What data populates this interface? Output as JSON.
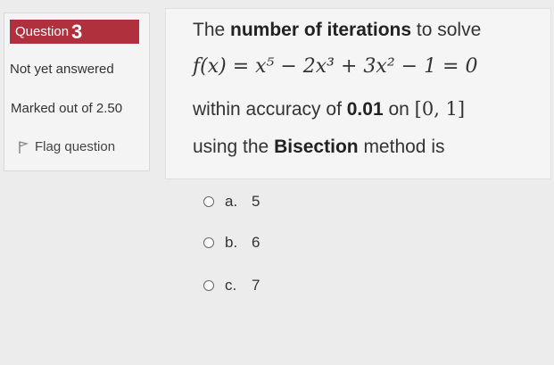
{
  "info": {
    "question_label": "Question",
    "question_number": "3",
    "state": "Not yet answered",
    "grade": "Marked out of 2.50",
    "flag_label": "Flag question"
  },
  "question": {
    "line1_pre": "The ",
    "line1_bold": "number of iterations",
    "line1_post": " to solve",
    "equation": "f(x) = x⁵ − 2x³ + 3x² − 1 = 0",
    "line3_pre": "within accuracy of ",
    "line3_bold": "0.01",
    "line3_mid": " on ",
    "line3_interval": "[0, 1]",
    "line4_pre": "using the ",
    "line4_bold": "Bisection",
    "line4_post": " method is"
  },
  "options": [
    {
      "letter": "a.",
      "value": "5"
    },
    {
      "letter": "b.",
      "value": "6"
    },
    {
      "letter": "c.",
      "value": "7"
    }
  ],
  "colors": {
    "question_badge": "#b0303d",
    "background": "#ececec"
  }
}
